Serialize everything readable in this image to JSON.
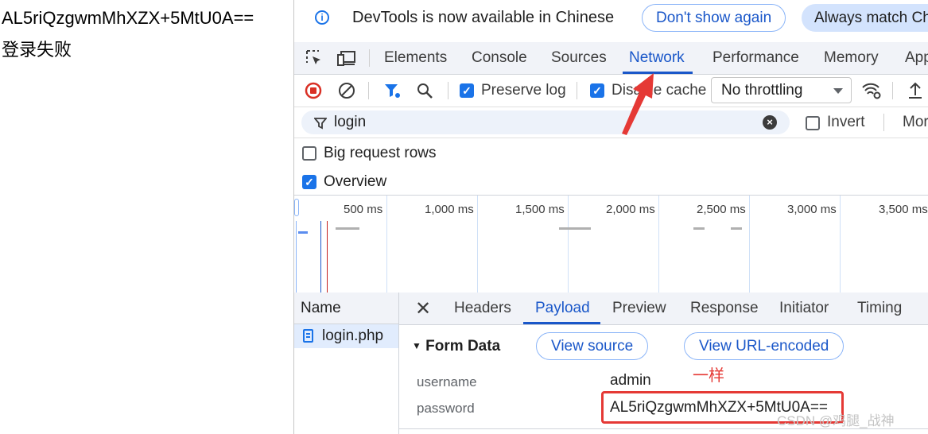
{
  "page": {
    "line1": "AL5riQzgwmMhXZX+5MtU0A==",
    "line2": "登录失败"
  },
  "infobar": {
    "message": "DevTools is now available in Chinese",
    "dont_show": "Don't show again",
    "always_match": "Always match Ch"
  },
  "tabs": {
    "items": [
      "Elements",
      "Console",
      "Sources",
      "Network",
      "Performance",
      "Memory",
      "App"
    ],
    "active": "Network"
  },
  "toolbar": {
    "preserve_log": "Preserve log",
    "disable_cache": "Disable cache",
    "throttling": "No throttling"
  },
  "filter": {
    "value": "login",
    "invert": "Invert",
    "more": "Mor"
  },
  "options": {
    "big_rows": "Big request rows",
    "overview": "Overview"
  },
  "timeline": {
    "ticks": [
      "500 ms",
      "1,000 ms",
      "1,500 ms",
      "2,000 ms",
      "2,500 ms",
      "3,000 ms",
      "3,500 ms"
    ]
  },
  "requests": {
    "header": "Name",
    "items": [
      "login.php"
    ]
  },
  "detail": {
    "tabs": [
      "Headers",
      "Payload",
      "Preview",
      "Response",
      "Initiator",
      "Timing"
    ],
    "active": "Payload",
    "section": "Form Data",
    "view_source": "View source",
    "view_url_encoded": "View URL-encoded",
    "rows": [
      {
        "key": "username",
        "value": "admin"
      },
      {
        "key": "password",
        "value": "AL5riQzgwmMhXZX+5MtU0A=="
      }
    ]
  },
  "annotation": {
    "note": "一样",
    "watermark": "CSDN @鸡腿_战神"
  }
}
